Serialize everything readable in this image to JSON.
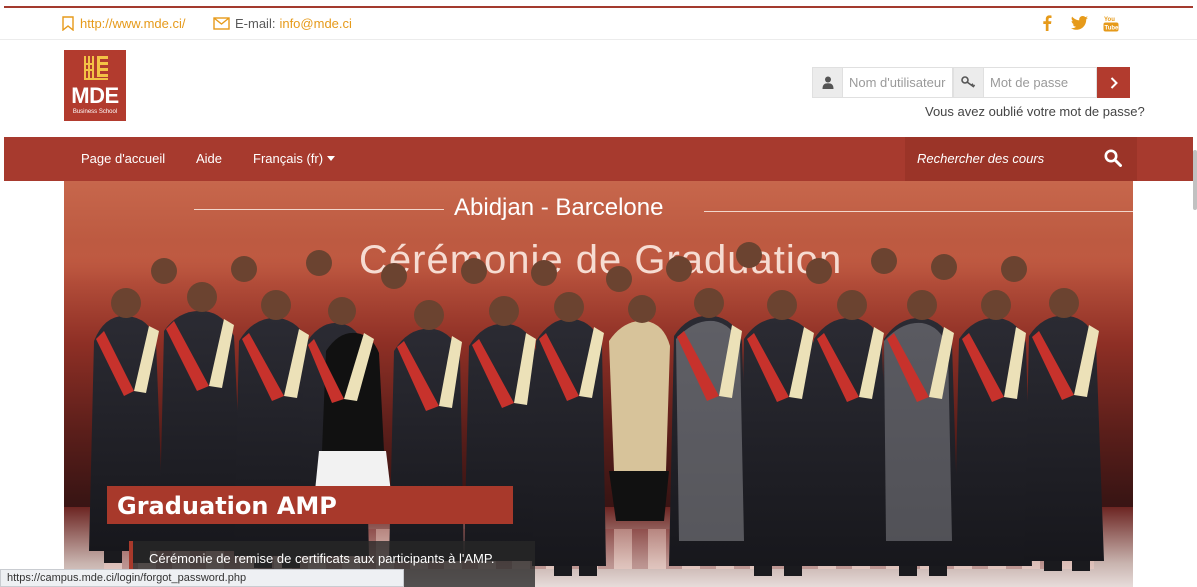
{
  "topbar": {
    "website": "http://www.mde.ci/",
    "email_label": "E-mail:",
    "email_value": "info@mde.ci",
    "social": [
      {
        "icon": "facebook-icon",
        "glyph": "f"
      },
      {
        "icon": "twitter-icon",
        "glyph": "t"
      },
      {
        "icon": "youtube-icon",
        "glyph": "You Tube"
      }
    ]
  },
  "logo": {
    "text": "MDE",
    "subtitle": "Business School"
  },
  "login": {
    "username_placeholder": "Nom d'utilisateur",
    "password_placeholder": "Mot de passe",
    "forgot": "Vous avez oublié votre mot de passe?"
  },
  "nav": {
    "items": [
      {
        "label": "Page d'accueil"
      },
      {
        "label": "Aide"
      },
      {
        "label": "Français (fr)"
      }
    ],
    "search_placeholder": "Rechercher des cours"
  },
  "hero": {
    "banner_line1": "Abidjan - Barcelone",
    "banner_line2": "Cérémonie de Graduation",
    "title": "Graduation AMP",
    "subtitle": "Cérémonie de remise de certificats aux participants à l'AMP."
  },
  "statusbar": {
    "url": "https://campus.mde.ci/login/forgot_password.php"
  },
  "colors": {
    "brand": "#a73a2e",
    "accent": "#e69a1a"
  }
}
